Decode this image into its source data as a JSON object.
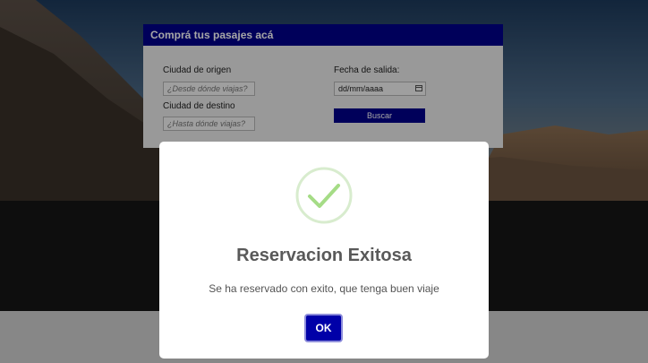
{
  "booking": {
    "title": "Comprá tus pasajes acá",
    "origin_label": "Ciudad de origen",
    "origin_placeholder": "¿Desde dónde viajas?",
    "destination_label": "Ciudad de destino",
    "destination_placeholder": "¿Hasta dónde viajas?",
    "date_label": "Fecha de salida:",
    "date_value": "dd/mm/aaaa",
    "search_label": "Buscar"
  },
  "modal": {
    "icon": "check-circle-icon",
    "title": "Reservacion Exitosa",
    "message": "Se ha reservado con exito, que tenga buen viaje",
    "ok_label": "OK"
  },
  "colors": {
    "header_blue": "#00008b",
    "ok_blue": "#0000a8",
    "success_green": "#a5dc86"
  }
}
